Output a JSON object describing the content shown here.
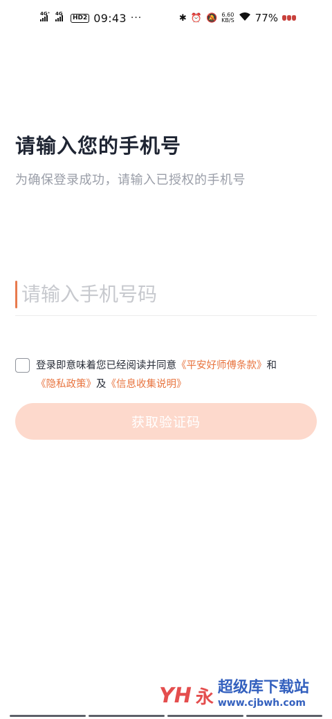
{
  "status_bar": {
    "net1": "4G⁺",
    "net2": "4G",
    "hd": "HD2",
    "time": "09:43",
    "dots": "···",
    "speed_value": "6.60",
    "speed_unit": "KB/S",
    "battery": "77%"
  },
  "login": {
    "title": "请输入您的手机号",
    "subtitle": "为确保登录成功，请输入已授权的手机号",
    "phone_placeholder": "请输入手机号码",
    "phone_value": "",
    "agree_prefix": "登录即意味着您已经阅读并同意",
    "terms_link": "《平安好师傅条款》",
    "and_text": "和",
    "privacy_link": "《隐私政策》",
    "and_text2": "及",
    "info_link": "《信息收集说明》",
    "button_label": "获取验证码",
    "agree_checked": false
  },
  "watermark": {
    "logo": "YH",
    "brand_text": "永",
    "site_name": "超级库下载站",
    "site_url": "www.cjbwh.com"
  },
  "colors": {
    "accent": "#e8743f",
    "button_bg": "#fdd9cc",
    "title": "#1f2533",
    "subtitle": "#9a9ea8"
  }
}
